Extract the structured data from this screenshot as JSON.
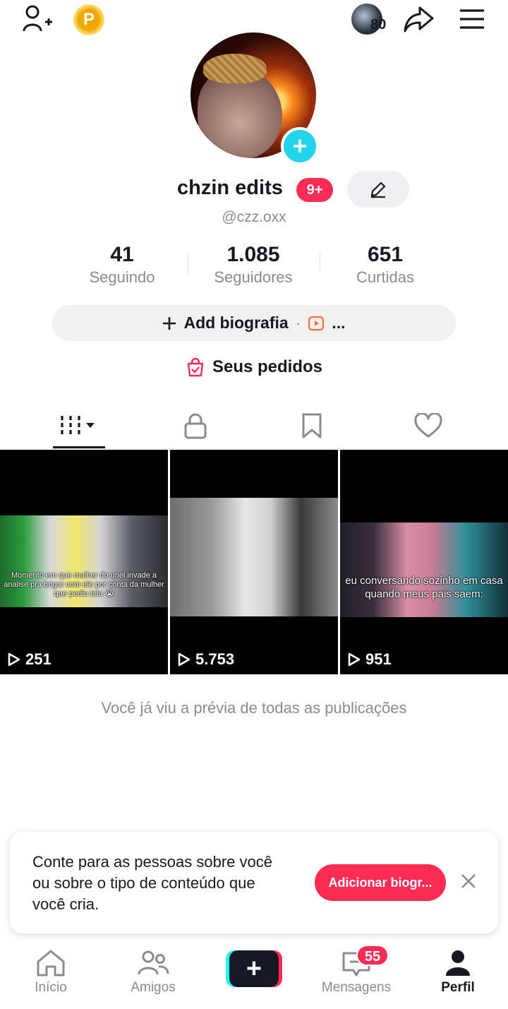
{
  "header": {
    "coin_letter": "P",
    "story_count": "80"
  },
  "profile": {
    "name": "chzin edits",
    "notification_badge": "9+",
    "handle": "@czz.oxx"
  },
  "stats": [
    {
      "value": "41",
      "label": "Seguindo"
    },
    {
      "value": "1.085",
      "label": "Seguidores"
    },
    {
      "value": "651",
      "label": "Curtidas"
    }
  ],
  "bio_button": {
    "label": "Add biografia",
    "separator": "·",
    "more": "..."
  },
  "orders": {
    "label": "Seus pedidos"
  },
  "tabs": [
    "videos",
    "private",
    "saved",
    "liked"
  ],
  "videos": [
    {
      "views": "251",
      "caption": "Momento em que mulher do uriel invade a analise pra brigar com ele por conta da mulher que pediu tela 😭"
    },
    {
      "views": "5.753",
      "caption": ""
    },
    {
      "views": "951",
      "caption": "eu conversando sozinho em casa quando meus pais saem:"
    }
  ],
  "end_message": "Você já viu a prévia de todas as publicações",
  "toast": {
    "text": "Conte para as pessoas sobre você ou sobre o tipo de conteúdo que você cria.",
    "button": "Adicionar biogr..."
  },
  "nav": {
    "home": "Início",
    "friends": "Amigos",
    "create": "+",
    "messages": "Mensagens",
    "messages_badge": "55",
    "profile": "Perfil"
  },
  "colors": {
    "accent": "#fe2c55",
    "cyan": "#25f4ee",
    "text": "#161823",
    "muted": "#8a8b91"
  }
}
